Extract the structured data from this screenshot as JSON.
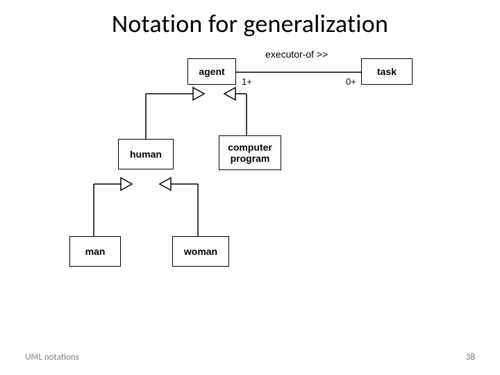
{
  "slide": {
    "title": "Notation for generalization",
    "footer_left": "UML notations",
    "page_number": "38"
  },
  "diagram": {
    "boxes": {
      "agent": "agent",
      "task": "task",
      "human": "human",
      "computer_program": "computer\nprogram",
      "man": "man",
      "woman": "woman"
    },
    "association": {
      "label": "executor-of >>",
      "mult_left": "1+",
      "mult_right": "0+"
    }
  }
}
